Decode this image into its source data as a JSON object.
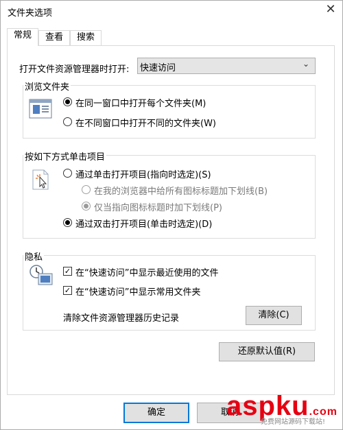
{
  "window": {
    "title": "文件夹选项",
    "close_glyph": "✕"
  },
  "tabs": [
    {
      "label": "常规",
      "active": true
    },
    {
      "label": "查看",
      "active": false
    },
    {
      "label": "搜索",
      "active": false
    }
  ],
  "open_explorer": {
    "label": "打开文件资源管理器时打开:",
    "selected": "快速访问",
    "arrow": "⌄"
  },
  "browse_folders": {
    "title": "浏览文件夹",
    "options": [
      {
        "label": "在同一窗口中打开每个文件夹(M)",
        "checked": true
      },
      {
        "label": "在不同窗口中打开不同的文件夹(W)",
        "checked": false
      }
    ]
  },
  "click_items": {
    "title": "按如下方式单击项目",
    "single_click": {
      "label": "通过单击打开项目(指向时选定)(S)",
      "checked": false
    },
    "underline_browser": {
      "label": "在我的浏览器中给所有图标标题加下划线(B)",
      "checked": false,
      "disabled": true
    },
    "underline_point": {
      "label": "仅当指向图标标题时加下划线(P)",
      "checked": true,
      "disabled": true
    },
    "double_click": {
      "label": "通过双击打开项目(单击时选定)(D)",
      "checked": true
    }
  },
  "privacy": {
    "title": "隐私",
    "show_recent_files": {
      "label": "在“快速访问”中显示最近使用的文件",
      "checked": true
    },
    "show_frequent_folders": {
      "label": "在“快速访问”中显示常用文件夹",
      "checked": true
    },
    "clear_history_label": "清除文件资源管理器历史记录",
    "clear_button": "清除(C)"
  },
  "restore_defaults_button": "还原默认值(R)",
  "footer": {
    "ok_button": "确定",
    "cancel_button": "取消"
  },
  "watermark": {
    "text": "aspku",
    "suffix": ".com",
    "subtitle": "免费网站源码下载站!"
  },
  "colors": {
    "accent": "#0078d7",
    "watermark": "#e60012"
  }
}
